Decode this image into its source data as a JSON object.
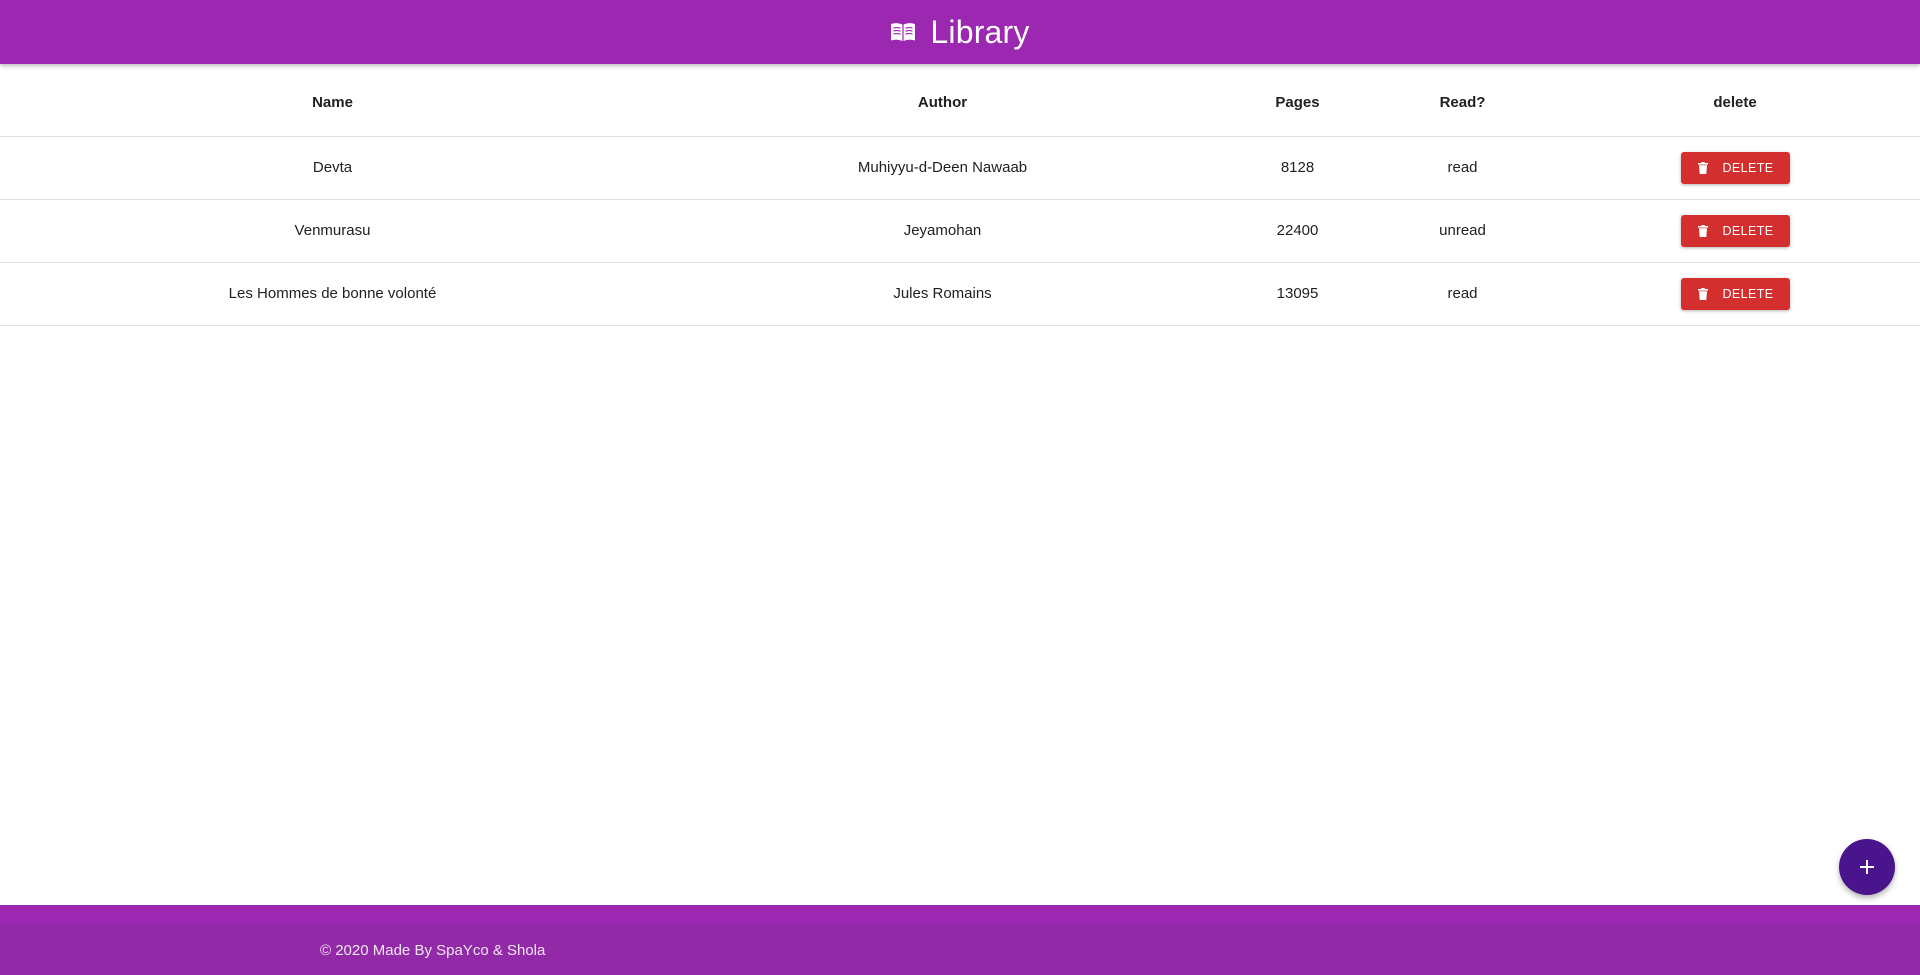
{
  "header": {
    "title": "Library",
    "icon": "book-open-icon",
    "background": "#9c27b0"
  },
  "table": {
    "columns": [
      "Name",
      "Author",
      "Pages",
      "Read?",
      "delete"
    ],
    "rows": [
      {
        "name": "Devta",
        "author": "Muhiyyu-d-Deen Nawaab",
        "pages": "8128",
        "read": "read",
        "delete_label": "DELETE"
      },
      {
        "name": "Venmurasu",
        "author": "Jeyamohan",
        "pages": "22400",
        "read": "unread",
        "delete_label": "DELETE"
      },
      {
        "name": "Les Hommes de bonne volonté",
        "author": "Jules Romains",
        "pages": "13095",
        "read": "read",
        "delete_label": "DELETE"
      }
    ],
    "delete_button_color": "#d32f2f"
  },
  "fab": {
    "icon": "plus-icon",
    "color": "#4a148c"
  },
  "footer": {
    "copyright": "© 2020 Made By SpaYco & Shola",
    "background": "#9c27b0"
  }
}
